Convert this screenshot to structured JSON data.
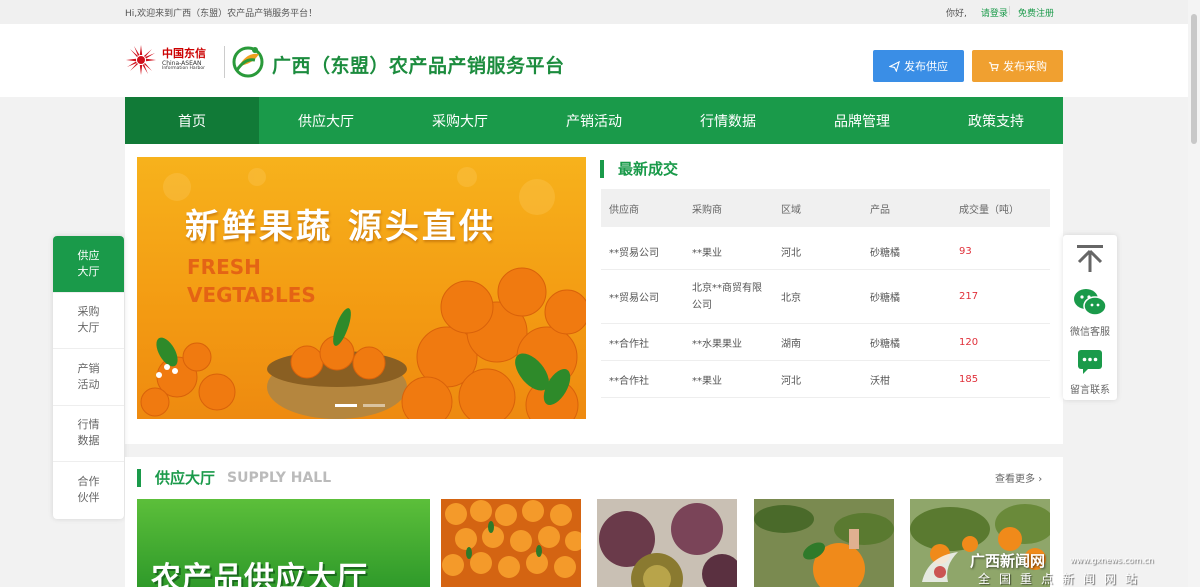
{
  "topbar": {
    "welcome": "Hi,欢迎来到广西（东盟）农产品产销服务平台！",
    "hello": "你好,",
    "login": "请登录",
    "register": "免费注册"
  },
  "header": {
    "logo_cn": "中国东信",
    "logo_en": "China-ASEAN",
    "logo_en2": "Information Harbor",
    "title": "广西（东盟）农产品产销服务平台",
    "btn_supply": "发布供应",
    "btn_purchase": "发布采购"
  },
  "nav": [
    "首页",
    "供应大厅",
    "采购大厅",
    "产销活动",
    "行情数据",
    "品牌管理",
    "政策支持"
  ],
  "banner": {
    "slogan": "新鲜果蔬 源头直供",
    "fresh": "FRESH",
    "vegetables": "VEGTABLES"
  },
  "deals": {
    "title": "最新成交",
    "headers": [
      "供应商",
      "采购商",
      "区域",
      "产品",
      "成交量（吨）"
    ],
    "rows": [
      [
        "**贸易公司",
        "**果业",
        "河北",
        "砂糖橘",
        "93"
      ],
      [
        "**贸易公司",
        "北京**商贸有限公司",
        "北京",
        "砂糖橘",
        "217"
      ],
      [
        "**合作社",
        "**水果果业",
        "湖南",
        "砂糖橘",
        "120"
      ],
      [
        "**合作社",
        "**果业",
        "河北",
        "沃柑",
        "185"
      ]
    ]
  },
  "leftnav": [
    "供应大厅",
    "采购大厅",
    "产销活动",
    "行情数据",
    "合作伙伴"
  ],
  "rightfloat": {
    "wechat": "微信客服",
    "message": "留言联系"
  },
  "supply": {
    "title": "供应大厅",
    "title_en": "SUPPLY HALL",
    "more": "查看更多",
    "card_text": "农产品供应大厅"
  },
  "watermark": {
    "cn": "广西新闻网",
    "url": "www.gxnews.com.cn",
    "sub": "全国重点新闻网站"
  },
  "colors": {
    "brand_green": "#1a9a4a",
    "supply_blue": "#3a8ee6",
    "purchase_orange": "#f0a030",
    "deal_red": "#e0303a"
  }
}
